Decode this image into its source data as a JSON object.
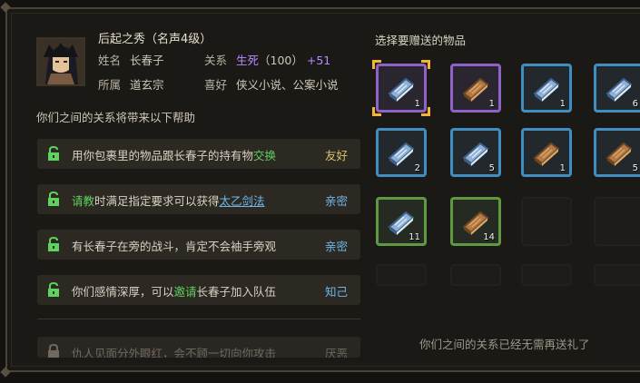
{
  "character": {
    "title": "后起之秀（名声4级）",
    "name_label": "姓名",
    "name": "长春子",
    "relation_label": "关系",
    "relation": "生死",
    "relation_score": "（100）",
    "relation_bonus": "+51",
    "faction_label": "所属",
    "faction": "道玄宗",
    "hobby_label": "喜好",
    "hobby": "侠义小说、公案小说"
  },
  "description": "你们之间的关系将带来以下帮助",
  "benefits": [
    {
      "pre": "用你包裹里的物品跟长春子的持有物",
      "hl": "交换",
      "post": "",
      "status": "友好"
    },
    {
      "pre": "",
      "hl": "请教",
      "mid": "时满足指定要求可以获得",
      "link": "太乙剑法",
      "status": "亲密"
    },
    {
      "pre": "有长春子在旁的战斗，肯定不会袖手旁观",
      "status": "亲密"
    },
    {
      "pre": "你们感情深厚，可以",
      "hl": "邀请",
      "post": "长春子加入队伍",
      "status": "知己"
    },
    {
      "pre": "仇人见面分外眼红，会不顾一切向你攻击",
      "status": "厌恶"
    }
  ],
  "gift_panel": {
    "title": "选择要赠送的物品",
    "footer": "你们之间的关系已经无需再送礼了",
    "items": [
      {
        "border": "purple",
        "book": "blue",
        "count": "1",
        "selected": true
      },
      {
        "border": "purple",
        "book": "brown",
        "count": "1"
      },
      {
        "border": "blue",
        "book": "blue",
        "count": "1"
      },
      {
        "border": "blue",
        "book": "blue",
        "count": "6"
      },
      {
        "border": "blue",
        "book": "blue",
        "count": "2"
      },
      {
        "border": "blue",
        "book": "blue",
        "count": "5"
      },
      {
        "border": "blue",
        "book": "brown",
        "count": "1"
      },
      {
        "border": "blue",
        "book": "brown",
        "count": "5"
      },
      {
        "border": "green",
        "book": "blue",
        "count": "11"
      },
      {
        "border": "green",
        "book": "brown",
        "count": "14"
      }
    ]
  },
  "colors": {
    "accent_purple": "#b58bff",
    "accent_green": "#5fd35f",
    "accent_blue": "#6fb7e8",
    "selected": "#f2b53a"
  }
}
